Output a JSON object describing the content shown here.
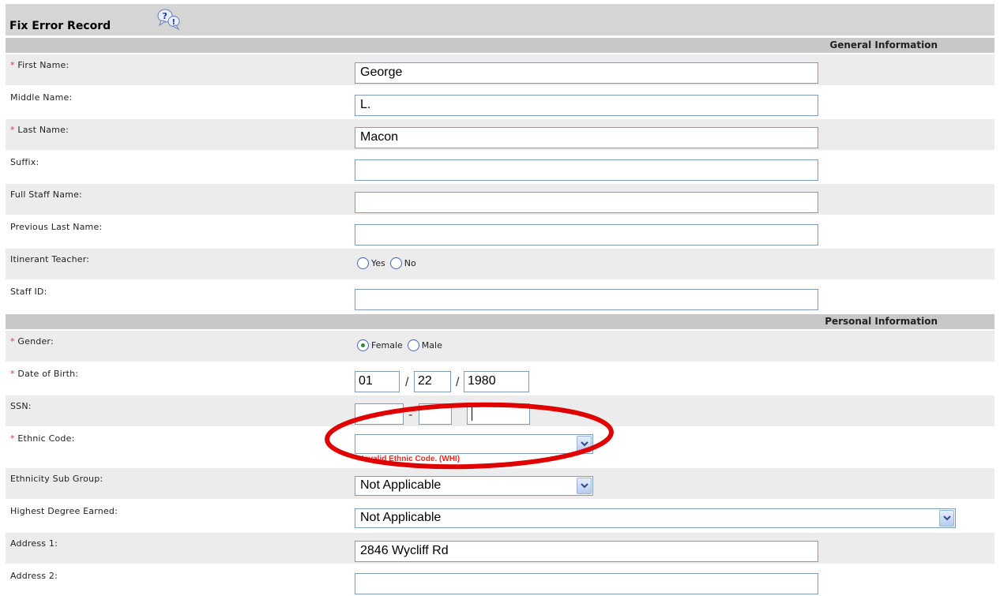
{
  "header": {
    "title": "Fix Error Record",
    "help_icon": "help-question-icon"
  },
  "sections": {
    "general": "General Information",
    "personal": "Personal Information"
  },
  "required_mark": "*",
  "general": {
    "first_name": {
      "label": "First Name:",
      "value": "George",
      "required": true
    },
    "middle_name": {
      "label": "Middle Name:",
      "value": "L."
    },
    "last_name": {
      "label": "Last Name:",
      "value": "Macon",
      "required": true
    },
    "suffix": {
      "label": "Suffix:",
      "value": ""
    },
    "full_staff_name": {
      "label": "Full Staff Name:",
      "value": ""
    },
    "previous_last_name": {
      "label": "Previous Last Name:",
      "value": ""
    },
    "itinerant_teacher": {
      "label": "Itinerant Teacher:",
      "options": [
        "Yes",
        "No"
      ],
      "selected": null
    },
    "staff_id": {
      "label": "Staff ID:",
      "value": ""
    }
  },
  "personal": {
    "gender": {
      "label": "Gender:",
      "options": [
        "Female",
        "Male"
      ],
      "selected": "Female",
      "required": true
    },
    "dob": {
      "label": "Date of Birth:",
      "month": "01",
      "day": "22",
      "year": "1980",
      "separator": "/",
      "required": true
    },
    "ssn": {
      "label": "SSN:",
      "part1": "",
      "part2": "",
      "part3": "",
      "separator": "-"
    },
    "ethnic_code": {
      "label": "Ethnic Code:",
      "value": "",
      "error": "* Invalid Ethnic Code. (WHI)",
      "required": true
    },
    "ethnicity_sub_group": {
      "label": "Ethnicity Sub Group:",
      "value": "Not Applicable"
    },
    "highest_degree": {
      "label": "Highest Degree Earned:",
      "value": "Not Applicable"
    },
    "address1": {
      "label": "Address 1:",
      "value": "2846 Wycliff Rd"
    },
    "address2": {
      "label": "Address 2:",
      "value": ""
    }
  },
  "colors": {
    "required": "#e23b2a",
    "error": "#ff2020",
    "highlight_ellipse": "#e00000",
    "header_bg": "#d5d5d5"
  }
}
